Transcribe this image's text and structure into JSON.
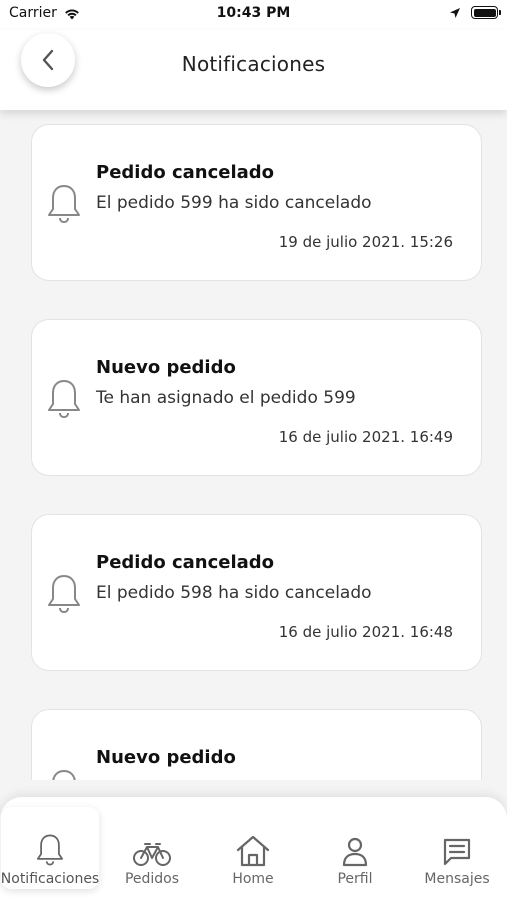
{
  "status_bar": {
    "carrier": "Carrier",
    "time": "10:43 PM"
  },
  "header": {
    "title": "Notificaciones"
  },
  "notifications": [
    {
      "title": "Pedido cancelado",
      "message": "El pedido 599 ha sido cancelado",
      "date": "19 de julio 2021. 15:26"
    },
    {
      "title": "Nuevo pedido",
      "message": "Te han asignado el pedido 599",
      "date": "16 de julio 2021. 16:49"
    },
    {
      "title": "Pedido cancelado",
      "message": "El pedido 598 ha sido cancelado",
      "date": "16 de julio 2021. 16:48"
    },
    {
      "title": "Nuevo pedido",
      "message": "",
      "date": ""
    }
  ],
  "tabbar": {
    "items": [
      {
        "label": "Notificaciones",
        "icon": "bell-icon",
        "active": true
      },
      {
        "label": "Pedidos",
        "icon": "bicycle-icon",
        "active": false
      },
      {
        "label": "Home",
        "icon": "home-icon",
        "active": false
      },
      {
        "label": "Perfil",
        "icon": "user-icon",
        "active": false
      },
      {
        "label": "Mensajes",
        "icon": "message-icon",
        "active": false
      }
    ]
  },
  "colors": {
    "background": "#f4f4f4",
    "card": "#ffffff",
    "text": "#222222",
    "icon": "#666666"
  }
}
